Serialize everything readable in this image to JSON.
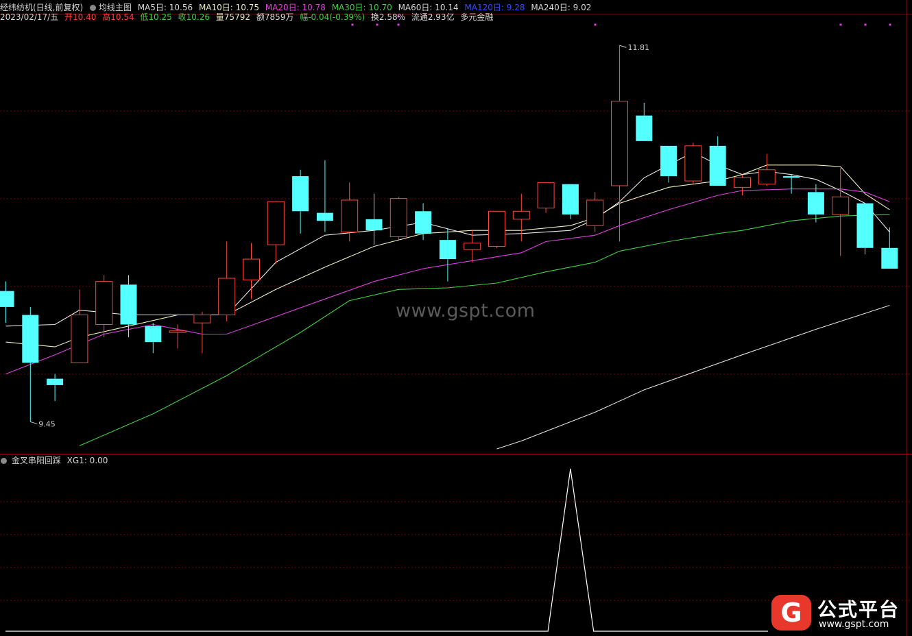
{
  "header": {
    "stock_name": "经纬纺机(日线,前复权)",
    "indicator_name": "均线主图",
    "ma5": "MA5日: 10.56",
    "ma10": "MA10日: 10.75",
    "ma20": "MA20日: 10.78",
    "ma30": "MA30日: 10.70",
    "ma60": "MA60日: 10.14",
    "ma120": "MA120日: 9.28",
    "ma240": "MA240日: 9.02",
    "date": "2023/02/17/五",
    "open": "开10.40",
    "high": "高10.54",
    "low": "低10.25",
    "close": "收10.26",
    "volume": "量75792",
    "amount": "额7859万",
    "change": "幅-0.04(-0.39%)",
    "turnover": "换2.58%",
    "float_cap": "流通2.93亿",
    "concept": "多元金融"
  },
  "indicator": {
    "label": "金叉串阳回踩",
    "xg_label": "XG1: 0.00"
  },
  "watermark": "www.gspt.com",
  "logo": {
    "glyph": "G",
    "name": "公式平台",
    "url": "www.gspt.com"
  },
  "colors": {
    "up": "#ff4a3d",
    "down": "#54ffff",
    "grid": "#7a0000",
    "ma5": "#e8e8e8",
    "ma10": "#f0f0c0",
    "ma20": "#e040e0",
    "ma30": "#40d040",
    "ma240": "#e0e0e0"
  },
  "chart_data": [
    {
      "type": "candlestick",
      "y_range": [
        9.25,
        12.0
      ],
      "annotations": [
        {
          "text": "11.81",
          "value": 11.81,
          "bar": 25
        },
        {
          "text": "9.45",
          "value": 9.45,
          "bar": 1
        }
      ],
      "candles": [
        {
          "o": 10.27,
          "h": 10.33,
          "l": 10.07,
          "c": 10.17
        },
        {
          "o": 10.12,
          "h": 10.17,
          "l": 9.45,
          "c": 9.82
        },
        {
          "o": 9.72,
          "h": 9.75,
          "l": 9.58,
          "c": 9.68
        },
        {
          "o": 9.82,
          "h": 10.28,
          "l": 9.82,
          "c": 10.12
        },
        {
          "o": 10.06,
          "h": 10.37,
          "l": 9.98,
          "c": 10.33
        },
        {
          "o": 10.31,
          "h": 10.37,
          "l": 9.98,
          "c": 10.06
        },
        {
          "o": 10.05,
          "h": 10.07,
          "l": 9.88,
          "c": 9.95
        },
        {
          "o": 10.01,
          "h": 10.06,
          "l": 9.91,
          "c": 10.02
        },
        {
          "o": 10.07,
          "h": 10.14,
          "l": 9.88,
          "c": 10.12
        },
        {
          "o": 10.12,
          "h": 10.58,
          "l": 10.08,
          "c": 10.35
        },
        {
          "o": 10.34,
          "h": 10.57,
          "l": 10.22,
          "c": 10.47
        },
        {
          "o": 10.56,
          "h": 10.77,
          "l": 10.44,
          "c": 10.83
        },
        {
          "o": 10.99,
          "h": 11.03,
          "l": 10.63,
          "c": 10.77
        },
        {
          "o": 10.76,
          "h": 11.09,
          "l": 10.64,
          "c": 10.71
        },
        {
          "o": 10.64,
          "h": 10.95,
          "l": 10.58,
          "c": 10.84
        },
        {
          "o": 10.72,
          "h": 10.88,
          "l": 10.56,
          "c": 10.65
        },
        {
          "o": 10.61,
          "h": 10.86,
          "l": 10.59,
          "c": 10.85
        },
        {
          "o": 10.77,
          "h": 10.82,
          "l": 10.59,
          "c": 10.63
        },
        {
          "o": 10.59,
          "h": 10.66,
          "l": 10.33,
          "c": 10.47
        },
        {
          "o": 10.53,
          "h": 10.65,
          "l": 10.45,
          "c": 10.57
        },
        {
          "o": 10.55,
          "h": 10.77,
          "l": 10.54,
          "c": 10.77
        },
        {
          "o": 10.72,
          "h": 10.88,
          "l": 10.58,
          "c": 10.77
        },
        {
          "o": 10.79,
          "h": 10.89,
          "l": 10.76,
          "c": 10.95
        },
        {
          "o": 10.94,
          "h": 10.89,
          "l": 10.72,
          "c": 10.75
        },
        {
          "o": 10.68,
          "h": 10.89,
          "l": 10.64,
          "c": 10.84
        },
        {
          "o": 10.93,
          "h": 11.81,
          "l": 10.58,
          "c": 11.46
        },
        {
          "o": 11.37,
          "h": 11.45,
          "l": 11.21,
          "c": 11.21
        },
        {
          "o": 11.18,
          "h": 11.18,
          "l": 10.95,
          "c": 10.99
        },
        {
          "o": 10.96,
          "h": 11.2,
          "l": 10.94,
          "c": 11.18
        },
        {
          "o": 11.18,
          "h": 11.24,
          "l": 10.93,
          "c": 10.93
        },
        {
          "o": 10.92,
          "h": 11.0,
          "l": 10.87,
          "c": 10.98
        },
        {
          "o": 10.94,
          "h": 11.13,
          "l": 10.93,
          "c": 11.03
        },
        {
          "o": 10.99,
          "h": 11.0,
          "l": 10.88,
          "c": 10.98
        },
        {
          "o": 10.89,
          "h": 10.94,
          "l": 10.7,
          "c": 10.75
        },
        {
          "o": 10.75,
          "h": 11.04,
          "l": 10.49,
          "c": 10.86
        },
        {
          "o": 10.82,
          "h": 10.82,
          "l": 10.5,
          "c": 10.54
        },
        {
          "o": 10.54,
          "h": 10.67,
          "l": 10.5,
          "c": 10.41
        }
      ],
      "ma_lines": [
        {
          "name": "MA5",
          "points": [
            [
              0,
              10.05
            ],
            [
              2,
              10.06
            ],
            [
              3,
              10.15
            ],
            [
              5,
              10.12
            ],
            [
              7,
              10.12
            ],
            [
              9,
              10.12
            ],
            [
              11,
              10.45
            ],
            [
              13,
              10.62
            ],
            [
              15,
              10.65
            ],
            [
              17,
              10.7
            ],
            [
              19,
              10.62
            ],
            [
              21,
              10.63
            ],
            [
              23,
              10.65
            ],
            [
              24,
              10.72
            ],
            [
              25,
              10.83
            ],
            [
              26,
              10.98
            ],
            [
              27,
              11.06
            ],
            [
              28,
              11.14
            ],
            [
              29,
              11.06
            ],
            [
              30,
              11.0
            ],
            [
              31,
              11.02
            ],
            [
              32,
              11.0
            ],
            [
              33,
              10.97
            ],
            [
              34,
              10.9
            ],
            [
              35,
              10.82
            ],
            [
              36,
              10.64
            ]
          ]
        },
        {
          "name": "MA10",
          "points": [
            [
              0,
              9.95
            ],
            [
              2,
              9.92
            ],
            [
              3,
              9.98
            ],
            [
              5,
              10.05
            ],
            [
              7,
              10.12
            ],
            [
              9,
              10.12
            ],
            [
              11,
              10.28
            ],
            [
              13,
              10.42
            ],
            [
              15,
              10.55
            ],
            [
              17,
              10.63
            ],
            [
              19,
              10.65
            ],
            [
              21,
              10.65
            ],
            [
              23,
              10.68
            ],
            [
              24,
              10.73
            ],
            [
              25,
              10.82
            ],
            [
              27,
              10.92
            ],
            [
              29,
              10.96
            ],
            [
              30,
              11.0
            ],
            [
              31,
              11.06
            ],
            [
              32,
              11.06
            ],
            [
              33,
              11.06
            ],
            [
              34,
              11.05
            ],
            [
              35,
              10.88
            ],
            [
              36,
              10.78
            ]
          ]
        },
        {
          "name": "MA20",
          "points": [
            [
              0,
              9.75
            ],
            [
              2,
              9.87
            ],
            [
              4,
              10.0
            ],
            [
              6,
              10.06
            ],
            [
              8,
              10.0
            ],
            [
              9,
              10.0
            ],
            [
              11,
              10.11
            ],
            [
              13,
              10.22
            ],
            [
              15,
              10.33
            ],
            [
              17,
              10.41
            ],
            [
              19,
              10.46
            ],
            [
              21,
              10.51
            ],
            [
              22,
              10.58
            ],
            [
              24,
              10.62
            ],
            [
              25,
              10.68
            ],
            [
              27,
              10.78
            ],
            [
              29,
              10.87
            ],
            [
              30,
              10.9
            ],
            [
              32,
              10.91
            ],
            [
              34,
              10.91
            ],
            [
              35,
              10.89
            ],
            [
              36,
              10.83
            ]
          ]
        },
        {
          "name": "MA30",
          "points": [
            [
              3,
              9.3
            ],
            [
              6,
              9.5
            ],
            [
              9,
              9.74
            ],
            [
              12,
              10.01
            ],
            [
              14,
              10.21
            ],
            [
              16,
              10.28
            ],
            [
              18,
              10.29
            ],
            [
              20,
              10.32
            ],
            [
              22,
              10.39
            ],
            [
              24,
              10.45
            ],
            [
              25,
              10.52
            ],
            [
              27,
              10.58
            ],
            [
              29,
              10.63
            ],
            [
              30,
              10.65
            ],
            [
              32,
              10.71
            ],
            [
              34,
              10.74
            ],
            [
              36,
              10.75
            ]
          ]
        },
        {
          "name": "MA240",
          "points": [
            [
              20,
              9.28
            ],
            [
              21,
              9.33
            ],
            [
              24,
              9.51
            ],
            [
              26,
              9.65
            ],
            [
              30,
              9.87
            ],
            [
              33,
              10.03
            ],
            [
              36,
              10.18
            ]
          ]
        }
      ]
    },
    {
      "type": "line",
      "name": "XG1",
      "y_range": [
        0,
        1
      ],
      "x": [
        0,
        22,
        23,
        24,
        37
      ],
      "values": [
        0,
        0,
        1,
        0,
        0
      ]
    }
  ]
}
